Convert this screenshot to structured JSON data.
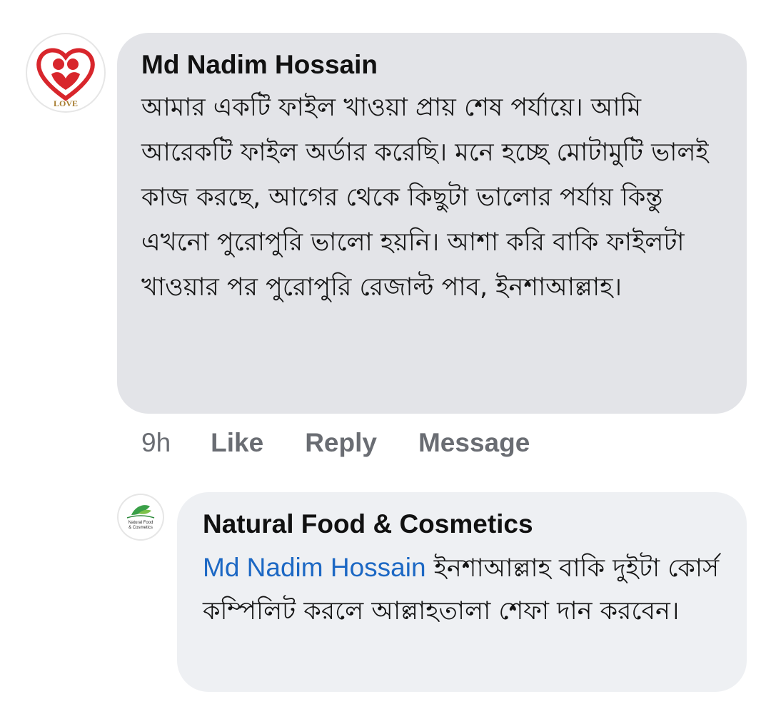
{
  "comment": {
    "author": "Md Nadim Hossain",
    "text": "আমার একটি ফাইল খাওয়া প্রায় শেষ পর্যায়ে। আমি আরেকটি ফাইল অর্ডার করেছি। মনে হচ্ছে মোটামুটি ভালই কাজ করছে, আগের থেকে কিছুটা ভালোর পর্যায় কিন্তু এখনো পুরোপুরি ভালো হয়নি। আশা করি বাকি ফাইলটা খাওয়ার পর পুরোপুরি রেজাল্ট পাব, ইনশাআল্লাহ।",
    "avatar_text": "LOVE",
    "time": "9h",
    "like_label": "Like",
    "reply_label": "Reply",
    "message_label": "Message"
  },
  "reply": {
    "author": "Natural Food & Cosmetics",
    "mention": "Md Nadim Hossain",
    "text": " ইনশাআল্লাহ বাকি দুইটা কোর্স কম্পিলিট করলে আল্লাহতালা শেফা দান করবেন।",
    "avatar_text_1": "Natural Food",
    "avatar_text_2": "& Cosmetics"
  },
  "colors": {
    "comment_bubble": "#e3e4e8",
    "reply_bubble": "#eef0f3",
    "mention": "#1c68c4",
    "action_text": "#6a6d73"
  }
}
